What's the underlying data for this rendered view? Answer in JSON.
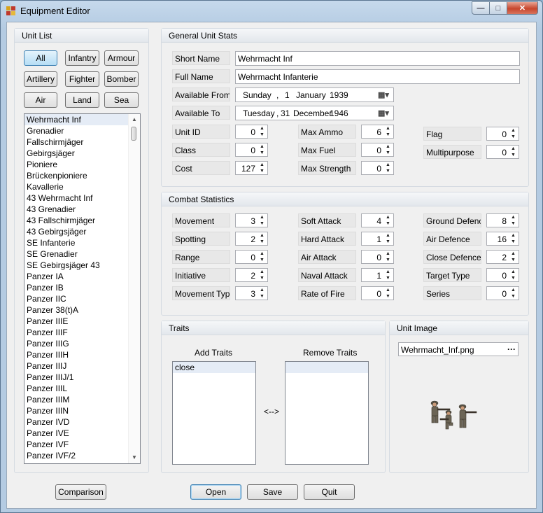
{
  "window": {
    "title": "Equipment Editor",
    "min": "—",
    "max": "□",
    "close": "✕"
  },
  "unit_list": {
    "header": "Unit List",
    "filters": [
      "All",
      "Infantry",
      "Armour",
      "Artillery",
      "Fighter",
      "Bomber",
      "Air",
      "Land",
      "Sea"
    ],
    "active_filter": "All",
    "items": [
      "Wehrmacht Inf",
      "Grenadier",
      "Fallschirmjäger",
      "Gebirgsjäger",
      "Pioniere",
      "Brückenpioniere",
      "Kavallerie",
      "43 Wehrmacht Inf",
      "43 Grenadier",
      "43 Fallschirmjäger",
      "43 Gebirgsjäger",
      "SE Infanterie",
      "SE Grenadier",
      "SE Gebirgsjäger 43",
      "Panzer IA",
      "Panzer IB",
      "Panzer IIC",
      "Panzer 38(t)A",
      "Panzer IIIE",
      "Panzer IIIF",
      "Panzer IIIG",
      "Panzer IIIH",
      "Panzer IIIJ",
      "Panzer IIIJ/1",
      "Panzer IIIL",
      "Panzer IIIM",
      "Panzer IIIN",
      "Panzer IVD",
      "Panzer IVE",
      "Panzer IVF",
      "Panzer IVF/2"
    ],
    "selected": "Wehrmacht Inf",
    "scroll_up": "▲",
    "scroll_down": "▼"
  },
  "general": {
    "header": "General Unit Stats",
    "short_name_label": "Short Name",
    "short_name": "Wehrmacht Inf",
    "full_name_label": "Full Name",
    "full_name": "Wehrmacht Infanterie",
    "available_from_label": "Available From",
    "available_from": {
      "weekday": "Sunday",
      "sep": ",",
      "day": "1",
      "month": "January",
      "year": "1939"
    },
    "available_to_label": "Available To",
    "available_to": {
      "weekday": "Tuesday",
      "sep": ",",
      "day": "31",
      "month": "December",
      "year": "1946"
    },
    "unit_id_label": "Unit ID",
    "unit_id": "0",
    "class_label": "Class",
    "class": "0",
    "cost_label": "Cost",
    "cost": "127",
    "max_ammo_label": "Max Ammo",
    "max_ammo": "6",
    "max_fuel_label": "Max Fuel",
    "max_fuel": "0",
    "max_strength_label": "Max Strength",
    "max_strength": "0",
    "flag_label": "Flag",
    "flag": "0",
    "multipurpose_label": "Multipurpose",
    "multipurpose": "0"
  },
  "combat": {
    "header": "Combat Statistics",
    "movement_label": "Movement",
    "movement": "3",
    "spotting_label": "Spotting",
    "spotting": "2",
    "range_label": "Range",
    "range": "0",
    "initiative_label": "Initiative",
    "initiative": "2",
    "movement_type_label": "Movement Type",
    "movement_type": "3",
    "soft_attack_label": "Soft Attack",
    "soft_attack": "4",
    "hard_attack_label": "Hard Attack",
    "hard_attack": "1",
    "air_attack_label": "Air Attack",
    "air_attack": "0",
    "naval_attack_label": "Naval Attack",
    "naval_attack": "1",
    "rate_of_fire_label": "Rate of Fire",
    "rate_of_fire": "0",
    "ground_defence_label": "Ground Defence",
    "ground_defence": "8",
    "air_defence_label": "Air Defence",
    "air_defence": "16",
    "close_defence_label": "Close Defence",
    "close_defence": "2",
    "target_type_label": "Target Type",
    "target_type": "0",
    "series_label": "Series",
    "series": "0"
  },
  "traits": {
    "header": "Traits",
    "add_label": "Add Traits",
    "remove_label": "Remove Traits",
    "add_items": [
      "close"
    ],
    "remove_items": [],
    "swap": "<-->"
  },
  "unit_image": {
    "header": "Unit Image",
    "filename": "Wehrmacht_Inf.png",
    "browse": "···"
  },
  "buttons": {
    "comparison": "Comparison",
    "open": "Open",
    "save": "Save",
    "quit": "Quit"
  },
  "icons": {
    "spin_up": "▲",
    "spin_down": "▼",
    "calendar": "▦",
    "dropdown": "▾"
  }
}
